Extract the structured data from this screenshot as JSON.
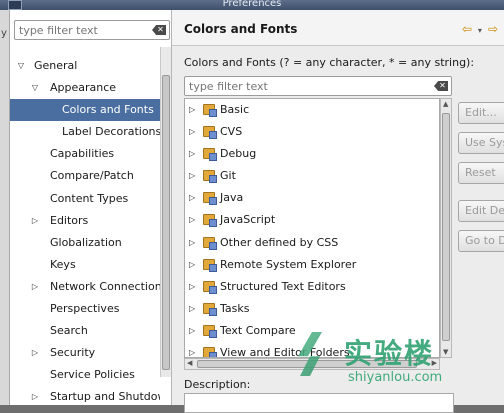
{
  "window": {
    "title": "Preferences"
  },
  "left": {
    "filter_placeholder": "type filter text",
    "tree": [
      {
        "label": "General",
        "level": 0,
        "expander": "expanded"
      },
      {
        "label": "Appearance",
        "level": 1,
        "expander": "expanded"
      },
      {
        "label": "Colors and Fonts",
        "level": 2,
        "expander": "none",
        "selected": true
      },
      {
        "label": "Label Decorations",
        "level": 2,
        "expander": "none"
      },
      {
        "label": "Capabilities",
        "level": 1,
        "expander": "none"
      },
      {
        "label": "Compare/Patch",
        "level": 1,
        "expander": "none"
      },
      {
        "label": "Content Types",
        "level": 1,
        "expander": "none"
      },
      {
        "label": "Editors",
        "level": 1,
        "expander": "collapsed"
      },
      {
        "label": "Globalization",
        "level": 1,
        "expander": "none"
      },
      {
        "label": "Keys",
        "level": 1,
        "expander": "none"
      },
      {
        "label": "Network Connections",
        "level": 1,
        "expander": "collapsed"
      },
      {
        "label": "Perspectives",
        "level": 1,
        "expander": "none"
      },
      {
        "label": "Search",
        "level": 1,
        "expander": "none"
      },
      {
        "label": "Security",
        "level": 1,
        "expander": "collapsed"
      },
      {
        "label": "Service Policies",
        "level": 1,
        "expander": "none"
      },
      {
        "label": "Startup and Shutdown",
        "level": 1,
        "expander": "collapsed"
      }
    ]
  },
  "page": {
    "title": "Colors and Fonts",
    "description": "Colors and Fonts (? = any character, * = any string):",
    "filter_placeholder": "type filter text",
    "categories": [
      "Basic",
      "CVS",
      "Debug",
      "Git",
      "Java",
      "JavaScript",
      "Other defined by CSS",
      "Remote System Explorer",
      "Structured Text Editors",
      "Tasks",
      "Text Compare",
      "View and Editor Folders"
    ],
    "description_label": "Description:",
    "buttons": {
      "edit": "Edit...",
      "use_system": "Use System Font",
      "reset": "Reset",
      "edit_default": "Edit Default...",
      "goto": "Go to Default"
    }
  },
  "watermark": {
    "cn": "实验楼",
    "en": "shiyanlou.com"
  },
  "colors": {
    "selection": "#4a6ea0",
    "folder": "#e2a93a",
    "watermark": "#2fa372"
  }
}
